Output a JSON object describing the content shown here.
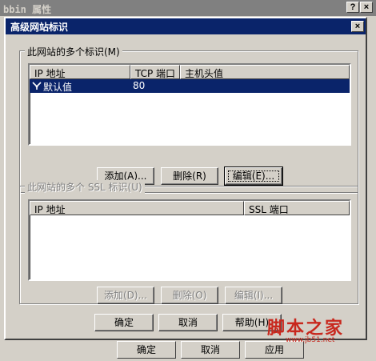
{
  "outer_window": {
    "title": "bbin 属性",
    "help_glyph": "?",
    "close_glyph": "×",
    "buttons": {
      "ok": "确定",
      "cancel": "取消",
      "apply": "应用"
    }
  },
  "dialog": {
    "title": "高级网站标识",
    "close_glyph": "×",
    "identities_group": {
      "label": "此网站的多个标识(M)",
      "columns": [
        "IP 地址",
        "TCP 端口",
        "主机头值"
      ],
      "rows": [
        {
          "ip": "默认值",
          "tcp_port": "80",
          "host_header": "",
          "selected": true,
          "icon": "network-icon"
        }
      ],
      "buttons": {
        "add": "添加(A)...",
        "remove": "删除(R)",
        "edit": "编辑(E)..."
      }
    },
    "ssl_group": {
      "label": "此网站的多个 SSL 标识(U)",
      "columns": [
        "IP 地址",
        "SSL 端口"
      ],
      "rows": [],
      "buttons": {
        "add": "添加(D)...",
        "remove": "删除(O)",
        "edit": "编辑(I)..."
      }
    },
    "buttons": {
      "ok": "确定",
      "cancel": "取消",
      "help": "帮助(H)"
    }
  },
  "watermark": {
    "text": "脚本之家",
    "url": "www.jb51.net"
  },
  "colors": {
    "face": "#d4d0c8",
    "active_title": "#0a246a",
    "inactive_title": "#808080",
    "selection": "#0a246a",
    "watermark": "#c8281e"
  }
}
